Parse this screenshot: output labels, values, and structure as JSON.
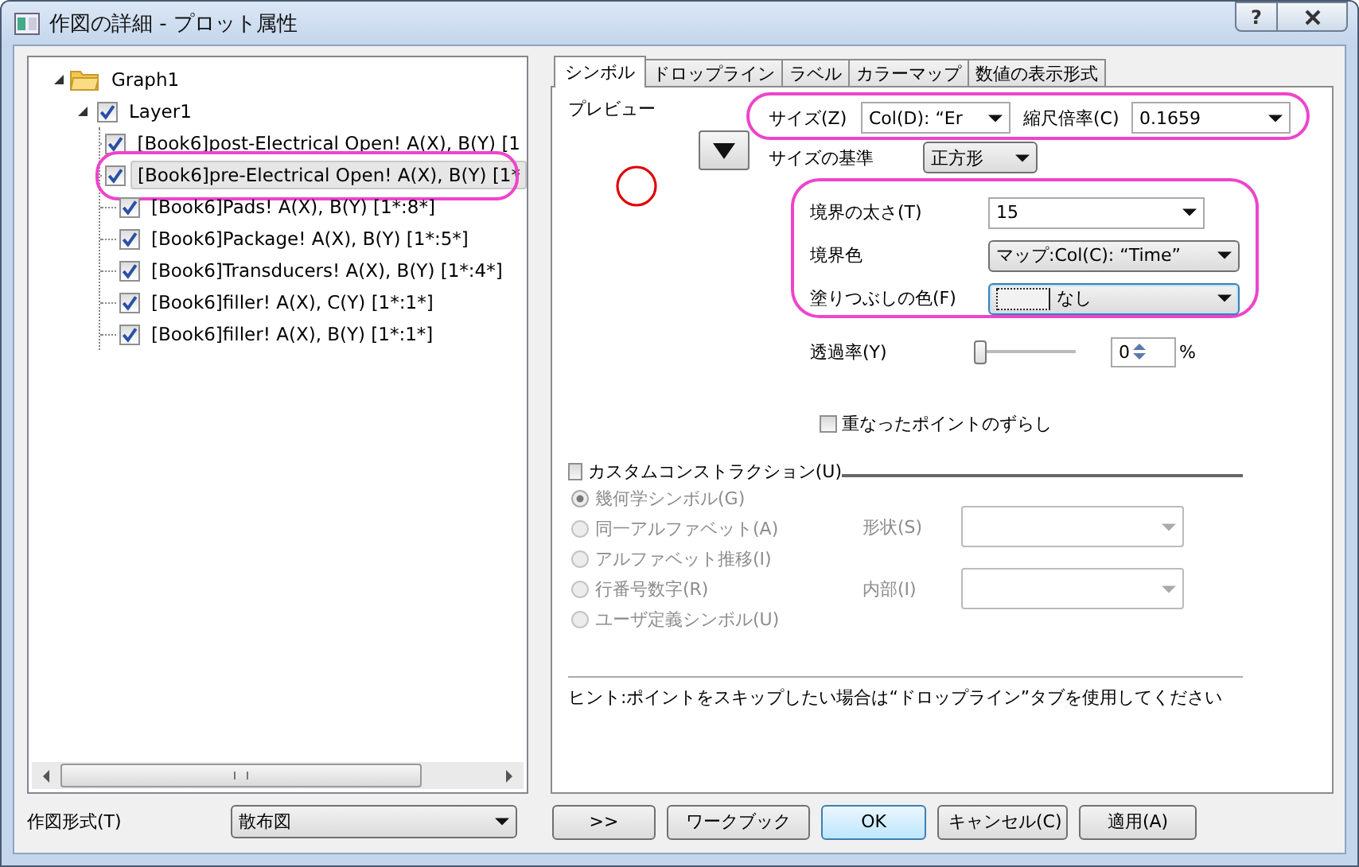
{
  "window": {
    "title": "作図の詳細 - プロット属性",
    "help_button": "?"
  },
  "tree": {
    "label": "Graph1",
    "expanded": true,
    "children": [
      {
        "label": "Layer1",
        "checked": true,
        "expanded": true,
        "children": [
          {
            "label": "[Book6]post-Electrical Open!  A(X), B(Y) [1",
            "checked": true,
            "selected": false,
            "highlighted": false
          },
          {
            "label": "[Book6]pre-Electrical Open!  A(X), B(Y) [1*",
            "checked": true,
            "selected": true,
            "highlighted": true
          },
          {
            "label": "[Book6]Pads!  A(X), B(Y) [1*:8*]",
            "checked": true,
            "selected": false,
            "highlighted": false
          },
          {
            "label": "[Book6]Package!  A(X), B(Y) [1*:5*]",
            "checked": true,
            "selected": false,
            "highlighted": false
          },
          {
            "label": "[Book6]Transducers!  A(X), B(Y) [1*:4*]",
            "checked": true,
            "selected": false,
            "highlighted": false
          },
          {
            "label": "[Book6]filler!  A(X), C(Y) [1*:1*]",
            "checked": true,
            "selected": false,
            "highlighted": false
          },
          {
            "label": "[Book6]filler!  A(X), B(Y) [1*:1*]",
            "checked": true,
            "selected": false,
            "highlighted": false
          }
        ]
      }
    ]
  },
  "plot_type": {
    "label": "作図形式(T)",
    "value": "散布図"
  },
  "tabs": [
    {
      "label": "シンボル",
      "selected": true
    },
    {
      "label": "ドロップライン",
      "selected": false
    },
    {
      "label": "ラベル",
      "selected": false
    },
    {
      "label": "カラーマップ",
      "selected": false
    },
    {
      "label": "数値の表示形式",
      "selected": false
    }
  ],
  "symbol": {
    "preview_label": "プレビュー",
    "size": {
      "label": "サイズ(Z)",
      "value": "Col(D): “Er"
    },
    "scale": {
      "label": "縮尺倍率(C)",
      "value": "0.1659"
    },
    "size_basis": {
      "label": "サイズの基準",
      "value": "正方形"
    },
    "edge_width": {
      "label": "境界の太さ(T)",
      "value": "15"
    },
    "edge_color": {
      "label": "境界色",
      "value": "マップ:Col(C): “Time”"
    },
    "fill_color": {
      "label": "塗りつぶしの色(F)",
      "value": "なし"
    },
    "transparency": {
      "label": "透過率(Y)",
      "level": 0,
      "value": "0",
      "unit": "%"
    },
    "offset_overlap": {
      "label": "重なったポイントのずらし",
      "checked": false
    },
    "custom_construction": {
      "label": "カスタムコンストラクション(U)",
      "checked": false
    },
    "construction_options": [
      {
        "label": "幾何学シンボル(G)",
        "selected": true
      },
      {
        "label": "同一アルファベット(A)",
        "selected": false
      },
      {
        "label": "アルファベット推移(I)",
        "selected": false
      },
      {
        "label": "行番号数字(R)",
        "selected": false
      },
      {
        "label": "ユーザ定義シンボル(U)",
        "selected": false
      }
    ],
    "shape": {
      "label": "形状(S)"
    },
    "interior": {
      "label": "内部(I)"
    },
    "hint": "ヒント:ポイントをスキップしたい場合は“ドロップライン”タブを使用してください"
  },
  "highlights": {
    "size_row": true,
    "edge_group": true
  },
  "buttons": [
    {
      "label": ">>",
      "default": false
    },
    {
      "label": "ワークブック",
      "default": false
    },
    {
      "label": "OK",
      "default": true
    },
    {
      "label": "キャンセル(C)",
      "default": false
    },
    {
      "label": "適用(A)",
      "default": false
    }
  ]
}
